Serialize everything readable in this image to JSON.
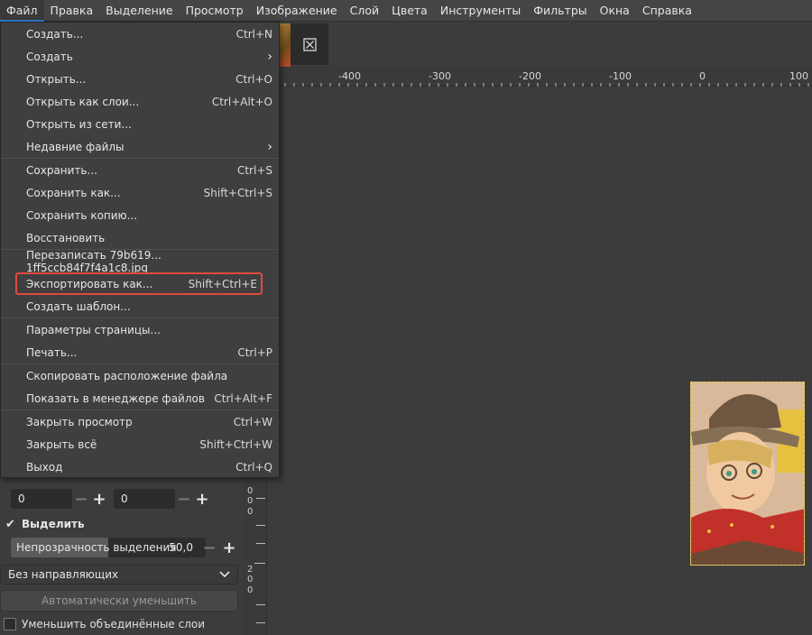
{
  "menubar": [
    "Файл",
    "Правка",
    "Выделение",
    "Просмотр",
    "Изображение",
    "Слой",
    "Цвета",
    "Инструменты",
    "Фильтры",
    "Окна",
    "Справка"
  ],
  "file_menu": {
    "items": [
      {
        "label": "Создать...",
        "shortcut": "Ctrl+N"
      },
      {
        "label": "Создать",
        "submenu": true
      },
      {
        "label": "Открыть...",
        "shortcut": "Ctrl+O"
      },
      {
        "label": "Открыть как слои...",
        "shortcut": "Ctrl+Alt+O"
      },
      {
        "label": "Открыть из сети..."
      },
      {
        "label": "Недавние файлы",
        "submenu": true
      },
      {
        "label": "Сохранить...",
        "shortcut": "Ctrl+S"
      },
      {
        "label": "Сохранить как...",
        "shortcut": "Shift+Ctrl+S"
      },
      {
        "label": "Сохранить копию..."
      },
      {
        "label": "Восстановить"
      },
      {
        "label": "Перезаписать 79b619... 1ff5ccb84f7f4a1c8.jpg"
      },
      {
        "label": "Экспортировать как...",
        "shortcut": "Shift+Ctrl+E"
      },
      {
        "label": "Создать шаблон..."
      },
      {
        "label": "Параметры страницы..."
      },
      {
        "label": "Печать...",
        "shortcut": "Ctrl+P"
      },
      {
        "label": "Скопировать расположение файла"
      },
      {
        "label": "Показать в менеджере файлов",
        "shortcut": "Ctrl+Alt+F"
      },
      {
        "label": "Закрыть просмотр",
        "shortcut": "Ctrl+W"
      },
      {
        "label": "Закрыть всё",
        "shortcut": "Shift+Ctrl+W"
      },
      {
        "label": "Выход",
        "shortcut": "Ctrl+Q"
      }
    ],
    "highlight_color": "#e04a3f"
  },
  "ruler_top": {
    "labels": [
      "-400",
      "-300",
      "-200",
      "-100",
      "0",
      "100"
    ]
  },
  "ruler_left": {
    "labels": [
      "0",
      "0",
      "0",
      "2",
      "0",
      "0"
    ]
  },
  "panel": {
    "spin1": "0",
    "spin2": "0",
    "highlight_label": "Выделить",
    "opacity_label": "Непрозрачность выделения",
    "opacity_value": "50,0",
    "opacity_fraction": 0.5,
    "guides": "Без направляющих",
    "auto_shrink": "Автоматически уменьшить",
    "merge_label": "Уменьшить объединённые слои"
  }
}
